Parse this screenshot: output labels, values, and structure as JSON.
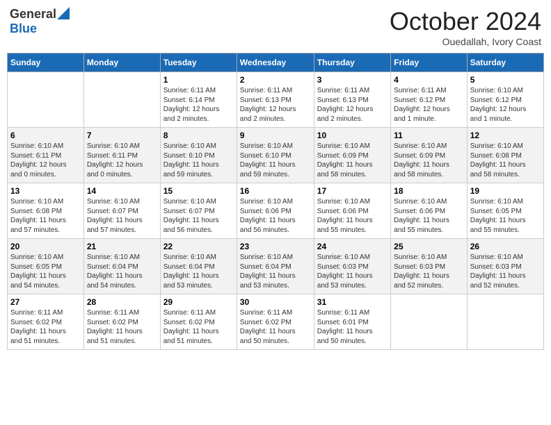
{
  "logo": {
    "general": "General",
    "blue": "Blue"
  },
  "title": "October 2024",
  "subtitle": "Ouedallah, Ivory Coast",
  "days_of_week": [
    "Sunday",
    "Monday",
    "Tuesday",
    "Wednesday",
    "Thursday",
    "Friday",
    "Saturday"
  ],
  "weeks": [
    [
      {
        "day": "",
        "detail": ""
      },
      {
        "day": "",
        "detail": ""
      },
      {
        "day": "1",
        "detail": "Sunrise: 6:11 AM\nSunset: 6:14 PM\nDaylight: 12 hours\nand 2 minutes."
      },
      {
        "day": "2",
        "detail": "Sunrise: 6:11 AM\nSunset: 6:13 PM\nDaylight: 12 hours\nand 2 minutes."
      },
      {
        "day": "3",
        "detail": "Sunrise: 6:11 AM\nSunset: 6:13 PM\nDaylight: 12 hours\nand 2 minutes."
      },
      {
        "day": "4",
        "detail": "Sunrise: 6:11 AM\nSunset: 6:12 PM\nDaylight: 12 hours\nand 1 minute."
      },
      {
        "day": "5",
        "detail": "Sunrise: 6:10 AM\nSunset: 6:12 PM\nDaylight: 12 hours\nand 1 minute."
      }
    ],
    [
      {
        "day": "6",
        "detail": "Sunrise: 6:10 AM\nSunset: 6:11 PM\nDaylight: 12 hours\nand 0 minutes."
      },
      {
        "day": "7",
        "detail": "Sunrise: 6:10 AM\nSunset: 6:11 PM\nDaylight: 12 hours\nand 0 minutes."
      },
      {
        "day": "8",
        "detail": "Sunrise: 6:10 AM\nSunset: 6:10 PM\nDaylight: 11 hours\nand 59 minutes."
      },
      {
        "day": "9",
        "detail": "Sunrise: 6:10 AM\nSunset: 6:10 PM\nDaylight: 11 hours\nand 59 minutes."
      },
      {
        "day": "10",
        "detail": "Sunrise: 6:10 AM\nSunset: 6:09 PM\nDaylight: 11 hours\nand 58 minutes."
      },
      {
        "day": "11",
        "detail": "Sunrise: 6:10 AM\nSunset: 6:09 PM\nDaylight: 11 hours\nand 58 minutes."
      },
      {
        "day": "12",
        "detail": "Sunrise: 6:10 AM\nSunset: 6:08 PM\nDaylight: 11 hours\nand 58 minutes."
      }
    ],
    [
      {
        "day": "13",
        "detail": "Sunrise: 6:10 AM\nSunset: 6:08 PM\nDaylight: 11 hours\nand 57 minutes."
      },
      {
        "day": "14",
        "detail": "Sunrise: 6:10 AM\nSunset: 6:07 PM\nDaylight: 11 hours\nand 57 minutes."
      },
      {
        "day": "15",
        "detail": "Sunrise: 6:10 AM\nSunset: 6:07 PM\nDaylight: 11 hours\nand 56 minutes."
      },
      {
        "day": "16",
        "detail": "Sunrise: 6:10 AM\nSunset: 6:06 PM\nDaylight: 11 hours\nand 56 minutes."
      },
      {
        "day": "17",
        "detail": "Sunrise: 6:10 AM\nSunset: 6:06 PM\nDaylight: 11 hours\nand 55 minutes."
      },
      {
        "day": "18",
        "detail": "Sunrise: 6:10 AM\nSunset: 6:06 PM\nDaylight: 11 hours\nand 55 minutes."
      },
      {
        "day": "19",
        "detail": "Sunrise: 6:10 AM\nSunset: 6:05 PM\nDaylight: 11 hours\nand 55 minutes."
      }
    ],
    [
      {
        "day": "20",
        "detail": "Sunrise: 6:10 AM\nSunset: 6:05 PM\nDaylight: 11 hours\nand 54 minutes."
      },
      {
        "day": "21",
        "detail": "Sunrise: 6:10 AM\nSunset: 6:04 PM\nDaylight: 11 hours\nand 54 minutes."
      },
      {
        "day": "22",
        "detail": "Sunrise: 6:10 AM\nSunset: 6:04 PM\nDaylight: 11 hours\nand 53 minutes."
      },
      {
        "day": "23",
        "detail": "Sunrise: 6:10 AM\nSunset: 6:04 PM\nDaylight: 11 hours\nand 53 minutes."
      },
      {
        "day": "24",
        "detail": "Sunrise: 6:10 AM\nSunset: 6:03 PM\nDaylight: 11 hours\nand 53 minutes."
      },
      {
        "day": "25",
        "detail": "Sunrise: 6:10 AM\nSunset: 6:03 PM\nDaylight: 11 hours\nand 52 minutes."
      },
      {
        "day": "26",
        "detail": "Sunrise: 6:10 AM\nSunset: 6:03 PM\nDaylight: 11 hours\nand 52 minutes."
      }
    ],
    [
      {
        "day": "27",
        "detail": "Sunrise: 6:11 AM\nSunset: 6:02 PM\nDaylight: 11 hours\nand 51 minutes."
      },
      {
        "day": "28",
        "detail": "Sunrise: 6:11 AM\nSunset: 6:02 PM\nDaylight: 11 hours\nand 51 minutes."
      },
      {
        "day": "29",
        "detail": "Sunrise: 6:11 AM\nSunset: 6:02 PM\nDaylight: 11 hours\nand 51 minutes."
      },
      {
        "day": "30",
        "detail": "Sunrise: 6:11 AM\nSunset: 6:02 PM\nDaylight: 11 hours\nand 50 minutes."
      },
      {
        "day": "31",
        "detail": "Sunrise: 6:11 AM\nSunset: 6:01 PM\nDaylight: 11 hours\nand 50 minutes."
      },
      {
        "day": "",
        "detail": ""
      },
      {
        "day": "",
        "detail": ""
      }
    ]
  ]
}
